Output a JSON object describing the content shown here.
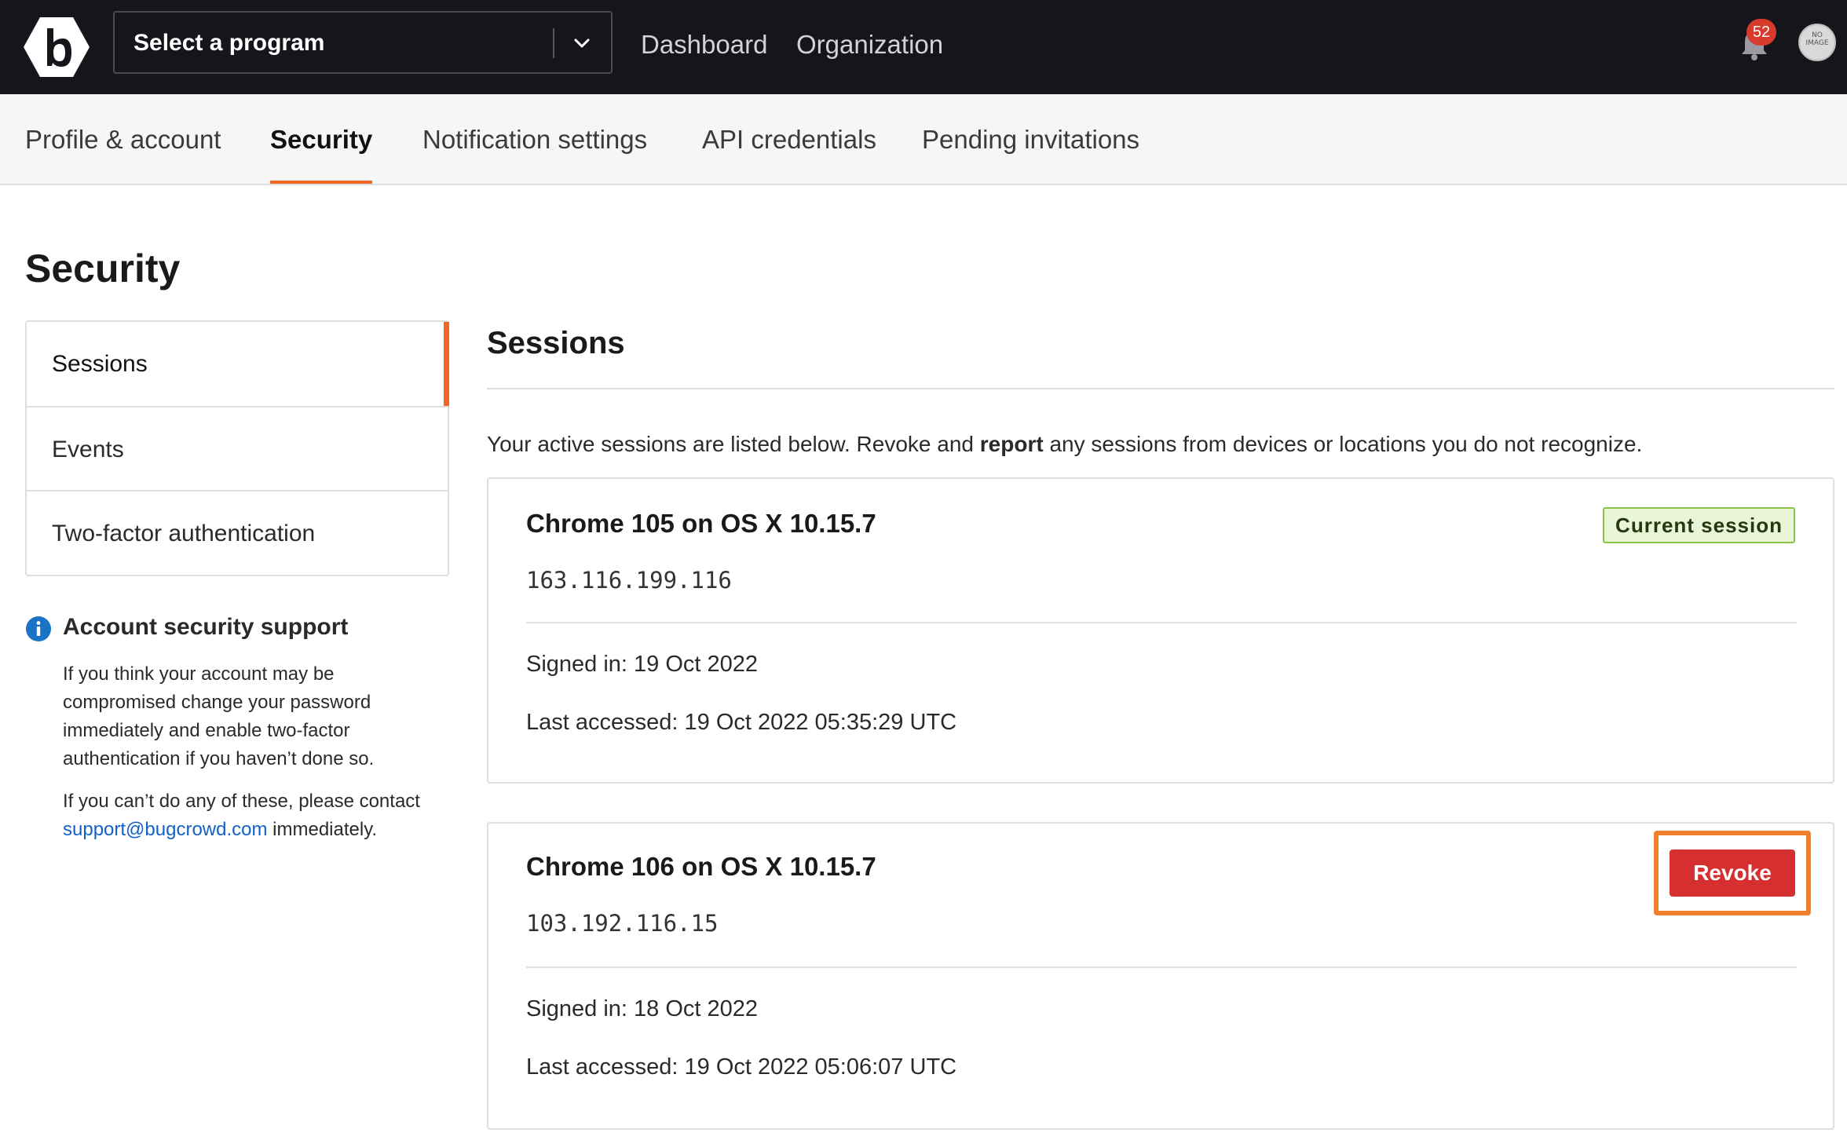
{
  "header": {
    "program_select": "Select a program",
    "nav": [
      "Dashboard",
      "Organization"
    ],
    "notifications_count": "52",
    "avatar_text": "NO IMAGE"
  },
  "tabs": [
    {
      "label": "Profile & account"
    },
    {
      "label": "Security",
      "active": true
    },
    {
      "label": "Notification settings"
    },
    {
      "label": "API credentials"
    },
    {
      "label": "Pending invitations"
    }
  ],
  "page_title": "Security",
  "side_menu": [
    {
      "label": "Sessions",
      "active": true
    },
    {
      "label": "Events"
    },
    {
      "label": "Two-factor authentication"
    }
  ],
  "support": {
    "title": "Account security support",
    "p1_lines": [
      "If you think your account may be",
      "compromised change your password",
      "immediately and enable two-factor",
      "authentication if you haven’t done so."
    ],
    "p2_line1": "If you can’t do any of these, please contact",
    "email": "support@bugcrowd.com",
    "p2_suffix": " immediately."
  },
  "sessions": {
    "title": "Sessions",
    "intro_before": "Your active sessions are listed below. Revoke and ",
    "intro_bold": "report",
    "intro_after": " any sessions from devices or locations you do not recognize.",
    "items": [
      {
        "browser": "Chrome 105 on OS X 10.15.7",
        "ip": "163.116.199.116",
        "signed_in": "Signed in: 19 Oct 2022",
        "last_accessed": "Last accessed: 19 Oct 2022 05:35:29 UTC",
        "badge": "Current session"
      },
      {
        "browser": "Chrome 106 on OS X 10.15.7",
        "ip": "103.192.116.15",
        "signed_in": "Signed in: 18 Oct 2022",
        "last_accessed": "Last accessed: 19 Oct 2022 05:06:07 UTC",
        "action": "Revoke"
      }
    ]
  },
  "colors": {
    "topbar": "#15151b",
    "accent": "#f26822",
    "revoke": "#d52f2f",
    "badge_bg": "#e9f4d8",
    "badge_border": "#8bc34a",
    "link": "#1261c9"
  }
}
